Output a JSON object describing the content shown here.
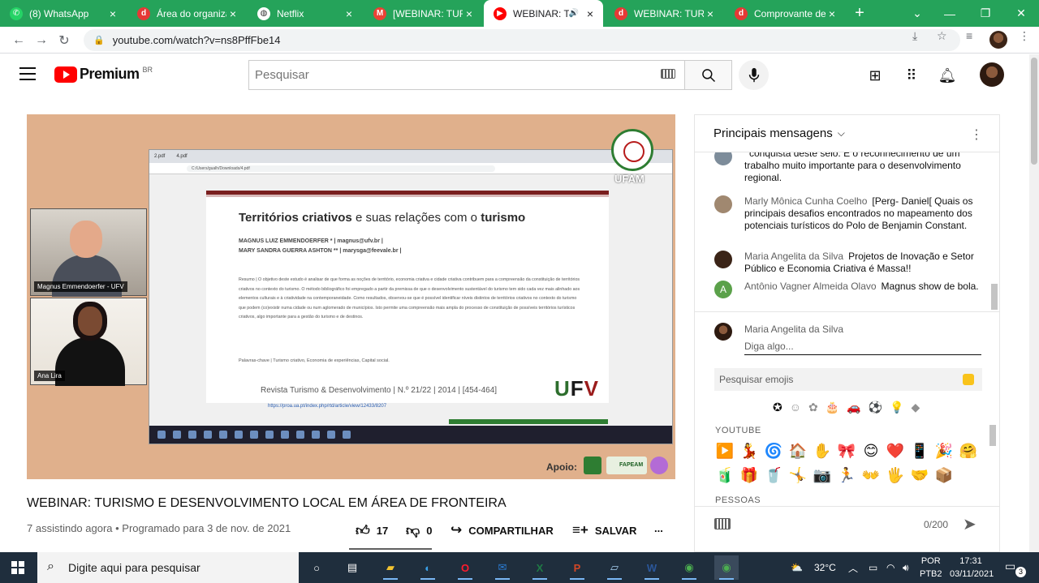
{
  "browser": {
    "tabs": [
      {
        "title": "(8) WhatsApp",
        "favicon": "whatsapp-icon",
        "color": "#25d366",
        "glyph": "✆"
      },
      {
        "title": "Área do organizad",
        "favicon": "doity-icon",
        "color": "#e53935",
        "glyph": "d"
      },
      {
        "title": "Netflix",
        "favicon": "globe-icon",
        "color": "#ffffff",
        "glyph": "◍"
      },
      {
        "title": "[WEBINAR: TURIS",
        "favicon": "gmail-icon",
        "color": "#ea4335",
        "glyph": "M"
      },
      {
        "title": "WEBINAR: TU",
        "favicon": "youtube-icon",
        "color": "#ff0000",
        "glyph": "▶",
        "active": true,
        "audio": "🔊"
      },
      {
        "title": "WEBINAR: TURIS",
        "favicon": "doity-icon",
        "color": "#e53935",
        "glyph": "d"
      },
      {
        "title": "Comprovante de",
        "favicon": "doity-icon",
        "color": "#e53935",
        "glyph": "d"
      }
    ],
    "url": "youtube.com/watch?v=ns8PffFbe14",
    "accent": "#25a35a"
  },
  "youtube": {
    "logo_text": "Premium",
    "country_code": "BR",
    "search_placeholder": "Pesquisar"
  },
  "video": {
    "title": "WEBINAR: TURISMO E DESENVOLVIMENTO LOCAL EM ÁREA DE FRONTEIRA",
    "meta": "7 assistindo agora • Programado para 3 de nov. de 2021",
    "likes": "17",
    "dislikes": "0",
    "share_label": "COMPARTILHAR",
    "save_label": "SALVAR",
    "more": "...",
    "content": {
      "cam1_name": "Magnus Emmendoerfer - UFV",
      "cam2_name": "Ana Lira",
      "inner_tabs": [
        "2.pdf",
        "4.pdf"
      ],
      "inner_url": "C:/Users/gualh/Downloads/4.pdf",
      "doc_title_bold": "Territórios criativos",
      "doc_title_light": " e suas relações com o ",
      "doc_title_end": "turismo",
      "author1": "MAGNUS LUIZ EMMENDOERFER * | magnus@ufv.br |",
      "author2": "MARY SANDRA GUERRA ASHTON ** | marysga@feevale.br |",
      "abstract": "Resumo | O objetivo deste estudo é analisar de que forma as noções de território, economia criativa e cidade criativa contribuem para a compreensão da constituição de territórios criativos no contexto do turismo. O método bibliográfico foi empregado a partir da premissa de que o desenvolvimento sustentável do turismo tem sido cada vez mais alinhado aos elementos culturais e à criatividade na contemporaneidade. Como resultados, observou-se que é possível identificar níveis distintos de territórios criativos no contexto do turismo que podem (co)existir numa cidade ou num aglomerado de municípios. Isto permite uma compreensão mais ampla do processo de constituição de possíveis territórios turísticos criativos, algo importante para a gestão do turismo e de destinos.",
      "keywords": "Palavras-chave | Turismo criativo, Economia de experiências, Capital social.",
      "journal": "Revista Turismo & Desenvolvimento | N.º 21/22 | 2014 | [454-464]",
      "doi_link": "https://proa.ua.pt/index.php/rtd/article/view/12433/8207",
      "logo_text": "UFV",
      "ufam_label": "UFAM",
      "apoio_label": "Apoio:",
      "sponsor2": "FAPEAM"
    }
  },
  "chat": {
    "header": "Principais mensagens",
    "messages": [
      {
        "author": "",
        "text": "conquista deste selo. É o reconhecimento de um trabalho muito importante para o desenvolvimento regional.",
        "avatar_color": "#7d8c9a"
      },
      {
        "author": "Marly Mônica Cunha Coelho",
        "text": "[Perg- Daniel[ Quais os principais desafios encontrados no mapeamento dos potenciais turísticos do Polo de Benjamin Constant.",
        "avatar_color": "#a08870"
      },
      {
        "author": "Maria Angelita da Silva",
        "text": "Projetos de Inovação e Setor Público e Economia Criativa é Massa!!",
        "avatar_color": "#3b2417"
      },
      {
        "author": "Antônio Vagner Almeida Olavo",
        "text": "Magnus show de bola.",
        "avatar_color": "#5ba14a",
        "initial": "A"
      }
    ],
    "composer_name": "Maria Angelita da Silva",
    "composer_placeholder": "Diga algo...",
    "emoji_search_placeholder": "Pesquisar emojis",
    "emoji_categories": [
      "✪",
      "☺",
      "✿",
      "🎂",
      "🚗",
      "⚽",
      "💡",
      "◆"
    ],
    "section_youtube": "YOUTUBE",
    "section_people": "PESSOAS",
    "emoji_row1": [
      "▶️",
      "💃",
      "🌀",
      "🏠",
      "✋",
      "🎀",
      "😊",
      "❤️",
      "📱",
      "🎉",
      "🤗"
    ],
    "emoji_row2": [
      "🧃",
      "🎁",
      "🥤",
      "🤸",
      "📷",
      "🏃",
      "👐",
      "🖐️",
      "🤝",
      "📦"
    ],
    "counter": "0/200"
  },
  "taskbar": {
    "search_placeholder": "Digite aqui para pesquisar",
    "apps": [
      {
        "name": "cortana-icon",
        "glyph": "○",
        "color": "#ffffff"
      },
      {
        "name": "task-view-icon",
        "glyph": "▤",
        "color": "#ffffff"
      },
      {
        "name": "file-explorer-icon",
        "glyph": "▰",
        "color": "#f4c430"
      },
      {
        "name": "edge-icon",
        "glyph": "◐",
        "color": "#3aa0e8"
      },
      {
        "name": "opera-icon",
        "glyph": "O",
        "color": "#ff1b2d"
      },
      {
        "name": "outlook-icon",
        "glyph": "✉",
        "color": "#2b7cd3"
      },
      {
        "name": "excel-icon",
        "glyph": "X",
        "color": "#1f7a45"
      },
      {
        "name": "powerpoint-icon",
        "glyph": "P",
        "color": "#d24726"
      },
      {
        "name": "notepad-icon",
        "glyph": "▱",
        "color": "#a8d0f0"
      },
      {
        "name": "word-icon",
        "glyph": "W",
        "color": "#2b579a"
      },
      {
        "name": "chrome-icon",
        "glyph": "◉",
        "color": "#4caf50"
      },
      {
        "name": "chrome-profile-icon",
        "glyph": "◉",
        "color": "#4caf50"
      }
    ],
    "weather": "32°C",
    "lang_top": "POR",
    "lang_bottom": "PTB2",
    "time": "17:31",
    "date": "03/11/2021",
    "notifications": "3"
  }
}
